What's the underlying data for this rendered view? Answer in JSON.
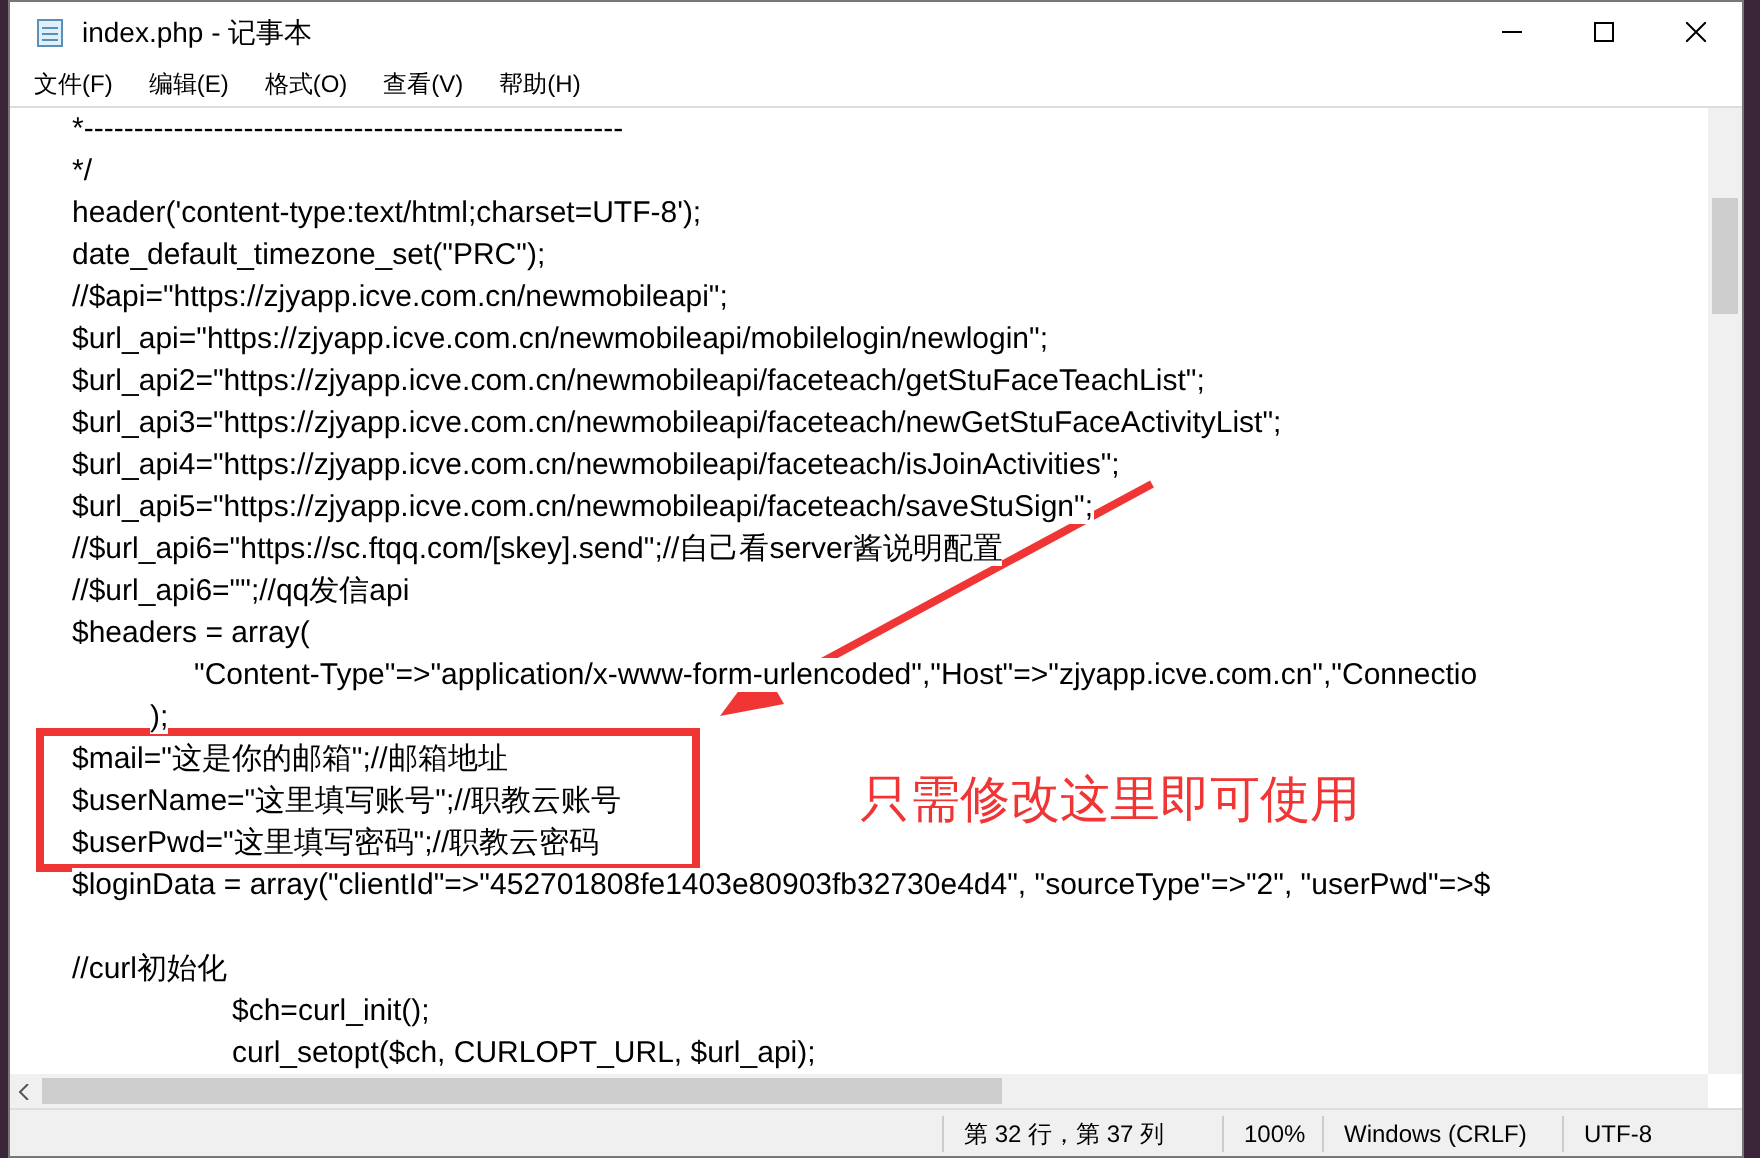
{
  "window": {
    "title": "index.php - 记事本"
  },
  "menu": [
    "文件(F)",
    "编辑(E)",
    "格式(O)",
    "查看(V)",
    "帮助(H)"
  ],
  "lines": [
    {
      "kind": "plain",
      "text": "*------------------------------------------------------"
    },
    {
      "kind": "plain",
      "text": "*/"
    },
    {
      "kind": "plain",
      "text": "header('content-type:text/html;charset=UTF-8');"
    },
    {
      "kind": "plain",
      "text": "date_default_timezone_set(\"PRC\");"
    },
    {
      "kind": "plain",
      "text": "//$api=\"https://zjyapp.icve.com.cn/newmobileapi\";"
    },
    {
      "kind": "plain",
      "text": "$url_api=\"https://zjyapp.icve.com.cn/newmobileapi/mobilelogin/newlogin\";"
    },
    {
      "kind": "plain",
      "text": "$url_api2=\"https://zjyapp.icve.com.cn/newmobileapi/faceteach/getStuFaceTeachList\";"
    },
    {
      "kind": "plain",
      "text": "$url_api3=\"https://zjyapp.icve.com.cn/newmobileapi/faceteach/newGetStuFaceActivityList\";"
    },
    {
      "kind": "plain",
      "text": "$url_api4=\"https://zjyapp.icve.com.cn/newmobileapi/faceteach/isJoinActivities\";"
    },
    {
      "kind": "plain",
      "text": "$url_api5=\"https://zjyapp.icve.com.cn/newmobileapi/faceteach/saveStuSign\";"
    },
    {
      "kind": "plain",
      "text": "//$url_api6=\"https://sc.ftqq.com/[skey].send\";//自己看server酱说明配置"
    },
    {
      "kind": "plain",
      "text": "//$url_api6=\"\";//qq发信api"
    },
    {
      "kind": "plain",
      "text": "$headers = array("
    },
    {
      "kind": "indent",
      "text": "\"Content-Type\"=>\"application/x-www-form-urlencoded\",\"Host\"=>\"zjyapp.icve.com.cn\",\"Connectio"
    },
    {
      "kind": "close",
      "text": ");"
    },
    {
      "kind": "plain",
      "text": "$mail=\"这是你的邮箱\";//邮箱地址"
    },
    {
      "kind": "plain",
      "text": "$userName=\"这里填写账号\";//职教云账号"
    },
    {
      "kind": "plain",
      "text": "$userPwd=\"这里填写密码\";//职教云密码"
    },
    {
      "kind": "plain",
      "text": "$loginData = array(\"clientId\"=>\"452701808fe1403e80903fb32730e4d4\", \"sourceType\"=>\"2\", \"userPwd\"=>$"
    },
    {
      "kind": "blank"
    },
    {
      "kind": "plain",
      "text": "//curl初始化"
    },
    {
      "kind": "deep",
      "text": "$ch=curl_init();"
    },
    {
      "kind": "deep",
      "text": "curl_setopt($ch, CURLOPT_URL, $url_api);"
    }
  ],
  "annotation": {
    "label": "只需修改这里即可使用"
  },
  "status_bar": [
    "第 32 行，第 37 列",
    "100%",
    "Windows (CRLF)",
    "UTF-8"
  ]
}
